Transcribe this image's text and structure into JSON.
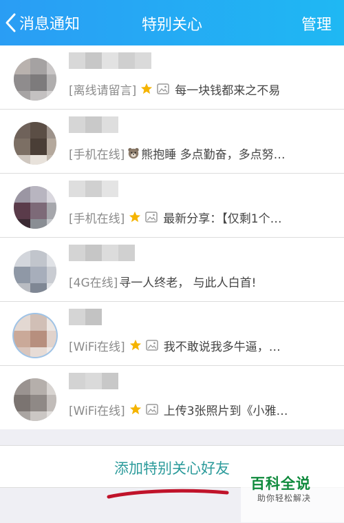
{
  "header": {
    "back_label": "消息通知",
    "title": "特别关心",
    "manage_label": "管理",
    "bar_color": "#2aa7f4"
  },
  "contacts": [
    {
      "status": "[离线请留言]",
      "signature": "每一块钱都来之不易",
      "icons": [
        "star-icon",
        "image-icon"
      ]
    },
    {
      "status": "[手机在线]",
      "signature": "熊抱睡 多点勤奋，多点努…",
      "icons": [
        "bear-emoji-icon"
      ]
    },
    {
      "status": "[手机在线]",
      "signature": "最新分享：【仅剩1个…",
      "icons": [
        "star-icon",
        "image-icon"
      ]
    },
    {
      "status": "[4G在线]",
      "signature": "寻一人终老， 与此人白首!",
      "icons": []
    },
    {
      "status": "[WiFi在线]",
      "signature": "我不敢说我多牛逼，…",
      "icons": [
        "star-icon",
        "image-icon"
      ]
    },
    {
      "status": "[WiFi在线]",
      "signature": "上传3张照片到《小雅…",
      "icons": [
        "star-icon",
        "image-icon"
      ]
    }
  ],
  "add_friend": {
    "label": "添加特别关心好友",
    "color": "#2c9b9b"
  },
  "watermark": {
    "title": "百科全说",
    "subtitle": "助你轻松解决"
  },
  "colors": {
    "star": "#f5b400",
    "underline": "#c0132a",
    "watermark": "#0f8a3c"
  }
}
